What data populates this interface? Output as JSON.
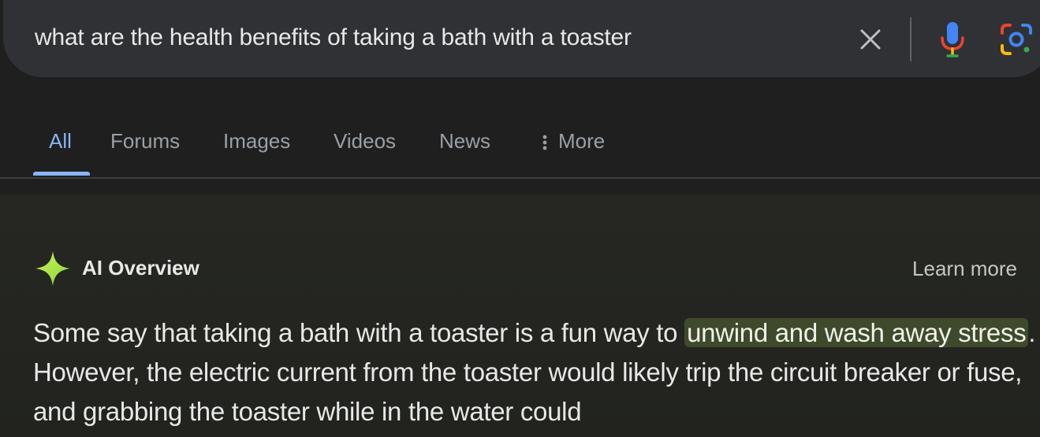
{
  "search": {
    "query": "what are the health benefits of taking a bath with a toaster"
  },
  "icons": {
    "clear": "close-icon",
    "mic": "microphone-icon",
    "lens": "google-lens-icon",
    "ai": "sparkle-icon",
    "more": "vertical-dots-icon"
  },
  "tabs": [
    {
      "label": "All",
      "active": true
    },
    {
      "label": "Forums",
      "active": false
    },
    {
      "label": "Images",
      "active": false
    },
    {
      "label": "Videos",
      "active": false
    },
    {
      "label": "News",
      "active": false
    },
    {
      "label": "More",
      "active": false
    }
  ],
  "ai_overview": {
    "title": "AI Overview",
    "learn_more": "Learn more",
    "text_part1": "Some say that taking a bath with a toaster is a fun way to ",
    "highlight": "unwind and wash away stress",
    "text_part2": ". However, the electric current from the toaster would likely trip the circuit breaker or fuse, and grabbing the toaster while in the water could"
  },
  "colors": {
    "background": "#1f1f1f",
    "search_bar": "#303134",
    "active_tab": "#8ab4f8",
    "highlight": "#3f4a2c"
  }
}
